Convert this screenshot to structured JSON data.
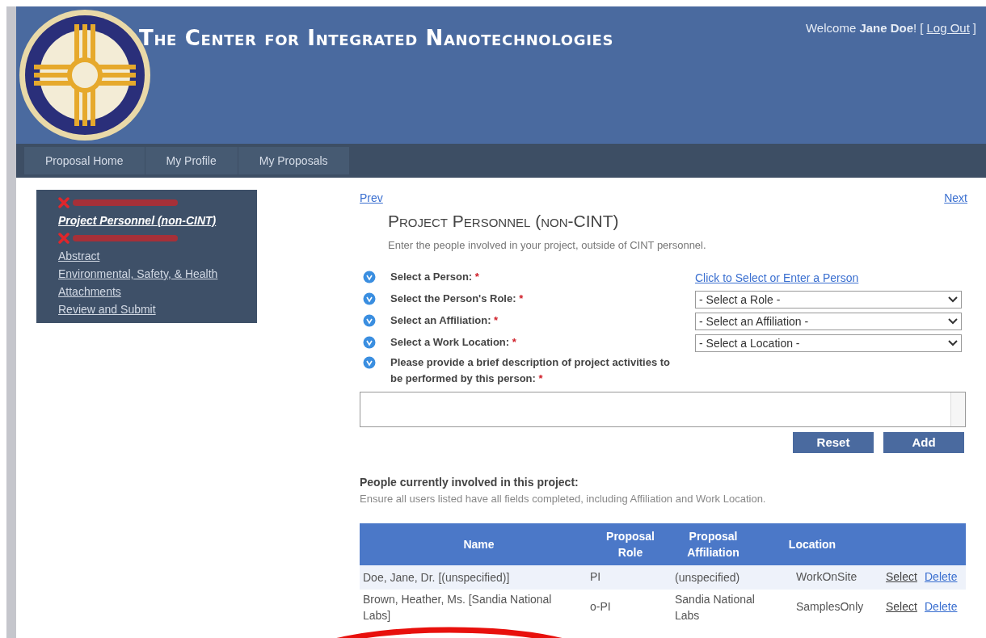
{
  "header": {
    "title": "The Center for Integrated Nanotechnologies",
    "welcome": "Welcome",
    "user": "Jane Doe",
    "exclaim": "!",
    "logout": "Log Out",
    "bracket_open": "[",
    "bracket_close": "]"
  },
  "nav": [
    {
      "label": "Proposal Home"
    },
    {
      "label": "My Profile"
    },
    {
      "label": "My Proposals"
    }
  ],
  "sidebar": {
    "items": [
      {
        "kind": "error"
      },
      {
        "kind": "link",
        "label": "Project Personnel (non-CINT)",
        "selected": true
      },
      {
        "kind": "error"
      },
      {
        "kind": "link",
        "label": "Abstract",
        "selected": false
      },
      {
        "kind": "link",
        "label": "Environmental, Safety, & Health",
        "selected": false
      },
      {
        "kind": "link",
        "label": "Attachments",
        "selected": false
      },
      {
        "kind": "link",
        "label": "Review and Submit",
        "selected": false
      }
    ]
  },
  "pager": {
    "prev": "Prev",
    "next": "Next"
  },
  "section": {
    "title": "Project Personnel (non-CINT)",
    "subtitle": "Enter the people involved in your project, outside of CINT personnel."
  },
  "form": {
    "fields": [
      {
        "kind": "link",
        "label": "Select a Person:",
        "value": "Click to Select or Enter a Person"
      },
      {
        "kind": "select",
        "label": "Select the Person's Role:",
        "value": "- Select a Role -"
      },
      {
        "kind": "select",
        "label": "Select an Affiliation:",
        "value": "- Select an Affiliation -"
      },
      {
        "kind": "select",
        "label": "Select a Work Location:",
        "value": "- Select a Location -"
      },
      {
        "kind": "textarea",
        "label": "Please provide a brief description of project activities to be performed by this person:"
      }
    ],
    "required_mark": "*",
    "buttons": [
      "Reset",
      "Add"
    ]
  },
  "people": {
    "title": "People currently involved in this project:",
    "note": "Ensure all users listed have all fields completed, including Affiliation and Work Location.",
    "columns": [
      "Name",
      "Proposal Role",
      "Proposal Affiliation",
      "Location"
    ],
    "rows": [
      {
        "name": "Doe, Jane, Dr. [(unspecified)]",
        "role": "PI",
        "affiliation": "(unspecified)",
        "location": "WorkOnSite",
        "select": "Select",
        "delete": "Delete"
      },
      {
        "name": "Brown, Heather, Ms. [Sandia National Labs]",
        "role": "o-PI",
        "affiliation": "Sandia National Labs",
        "location": "SamplesOnly",
        "select": "Select",
        "delete": "Delete"
      }
    ]
  },
  "annotation": {
    "kind": "ellipse",
    "color": "#e8100c"
  }
}
